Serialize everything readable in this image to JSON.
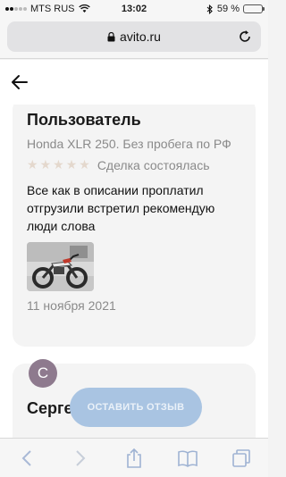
{
  "status_bar": {
    "carrier": "MTS RUS",
    "time": "13:02",
    "battery": "59 %",
    "battery_level": 0.59
  },
  "browser": {
    "url": "avito.ru"
  },
  "reviews": [
    {
      "name": "Пользователь",
      "item": "Honda XLR 250. Без пробега по РФ",
      "rating": 0,
      "stars_total": 5,
      "deal_status": "Сделка состоялась",
      "text": "Все как в описании проплатил отгрузили встретил рекомендую люди слова",
      "date": "11 ноября 2021"
    },
    {
      "avatar_letter": "С",
      "name": "Серге"
    }
  ],
  "actions": {
    "leave_review": "ОСТАВИТЬ ОТЗЫВ"
  },
  "colors": {
    "button_bg": "#a9c4e2",
    "card_bg": "#f4f4f4",
    "avatar_bg": "#8e7a8e",
    "star_color": "#e4d8cd"
  }
}
